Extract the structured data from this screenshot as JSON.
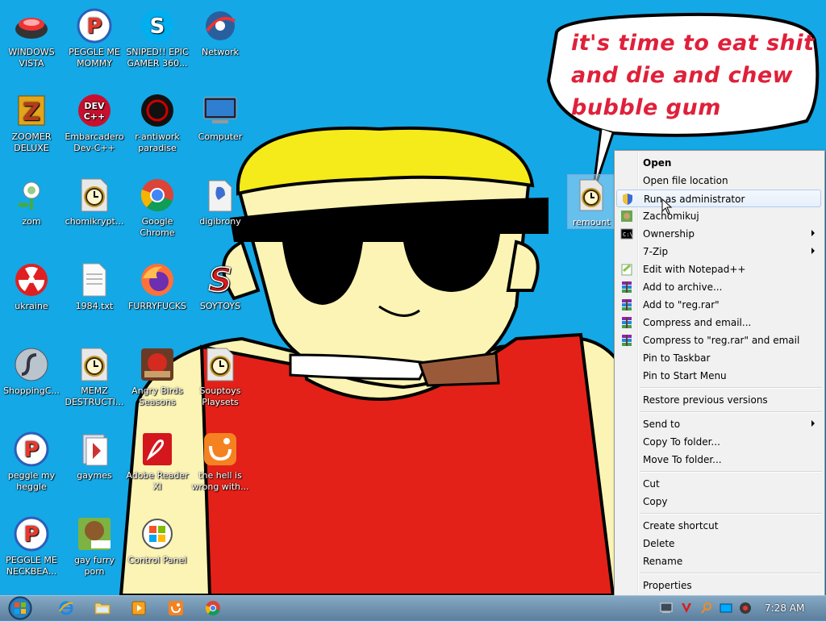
{
  "speech_bubble": {
    "lines": [
      "it's time to eat shit",
      "and die and chew",
      "bubble gum"
    ]
  },
  "desktop_icons": [
    {
      "label": "WINDOWS\nVISTA",
      "icon": "vista-bowl-icon"
    },
    {
      "label": "PEGGLE ME\nMOMMY",
      "icon": "peggle-icon"
    },
    {
      "label": "SNIPED!! EPIC\nGAMER 360...",
      "icon": "skype-icon"
    },
    {
      "label": "Network",
      "icon": "network-icon"
    },
    {
      "label": "ZOOMER\nDELUXE",
      "icon": "zuma-icon"
    },
    {
      "label": "Embarcadero\nDev-C++",
      "icon": "devcpp-icon"
    },
    {
      "label": "r-antiwork\nparadise",
      "icon": "antiwork-icon"
    },
    {
      "label": "Computer",
      "icon": "computer-icon"
    },
    {
      "label": "zom",
      "icon": "zombie-flower-icon"
    },
    {
      "label": "chomikrypt...",
      "icon": "clock-file-icon"
    },
    {
      "label": "Google\nChrome",
      "icon": "chrome-icon"
    },
    {
      "label": "digibrony",
      "icon": "pony-icon"
    },
    {
      "label": "ukraine",
      "icon": "radiation-icon"
    },
    {
      "label": "1984.txt",
      "icon": "text-file-icon"
    },
    {
      "label": "FURRYFUCKS",
      "icon": "firefox-icon"
    },
    {
      "label": "SOYTOYS",
      "icon": "soytoys-icon"
    },
    {
      "label": "ShoppingC...",
      "icon": "flash-icon"
    },
    {
      "label": "MEMZ\nDESTRUCTI...",
      "icon": "clock-file-icon"
    },
    {
      "label": "Angry Birds\nSeasons",
      "icon": "angry-birds-icon"
    },
    {
      "label": "Souptoys\nPlaysets",
      "icon": "clock-file-icon"
    },
    {
      "label": "peggle my\nheggle",
      "icon": "peggle-icon"
    },
    {
      "label": "gaymes",
      "icon": "games-folder-icon"
    },
    {
      "label": "Adobe Reader\nXI",
      "icon": "adobe-reader-icon"
    },
    {
      "label": "the hell is\nwrong with...",
      "icon": "uc-browser-icon"
    },
    {
      "label": "PEGGLE ME\nNECKBEA...",
      "icon": "peggle-icon"
    },
    {
      "label": "gay furry\nporn",
      "icon": "box-game-icon"
    },
    {
      "label": "Control Panel",
      "icon": "control-panel-icon"
    }
  ],
  "selected_icon": {
    "label": "remount"
  },
  "context_menu": {
    "items": [
      {
        "label": "Open",
        "bold": true
      },
      {
        "label": "Open file location"
      },
      {
        "label": "Run as administrator",
        "icon": "shield-icon",
        "hover": true
      },
      {
        "label": "Zachomikuj",
        "icon": "chomikuj-icon"
      },
      {
        "label": "Ownership",
        "icon": "cmd-icon",
        "submenu": true
      },
      {
        "label": "7-Zip",
        "submenu": true
      },
      {
        "label": "Edit with Notepad++",
        "icon": "notepadpp-icon"
      },
      {
        "label": "Add to archive...",
        "icon": "winrar-icon"
      },
      {
        "label": "Add to \"reg.rar\"",
        "icon": "winrar-icon"
      },
      {
        "label": "Compress and email...",
        "icon": "winrar-icon"
      },
      {
        "label": "Compress to \"reg.rar\" and email",
        "icon": "winrar-icon"
      },
      {
        "label": "Pin to Taskbar"
      },
      {
        "label": "Pin to Start Menu"
      },
      {
        "sep": true
      },
      {
        "label": "Restore previous versions"
      },
      {
        "sep": true
      },
      {
        "label": "Send to",
        "submenu": true
      },
      {
        "label": "Copy To folder..."
      },
      {
        "label": "Move To folder..."
      },
      {
        "sep": true
      },
      {
        "label": "Cut"
      },
      {
        "label": "Copy"
      },
      {
        "sep": true
      },
      {
        "label": "Create shortcut"
      },
      {
        "label": "Delete"
      },
      {
        "label": "Rename"
      },
      {
        "sep": true
      },
      {
        "label": "Properties"
      }
    ]
  },
  "taskbar": {
    "pinned": [
      "start-orb-icon",
      "internet-explorer-icon",
      "explorer-folder-icon",
      "media-player-icon",
      "uc-browser-icon",
      "chrome-icon"
    ],
    "tray": [
      "network-tray-icon",
      "antivirus-tray-icon",
      "search-tray-icon",
      "display-tray-icon",
      "volume-tray-icon"
    ],
    "clock": "7:28 AM"
  }
}
